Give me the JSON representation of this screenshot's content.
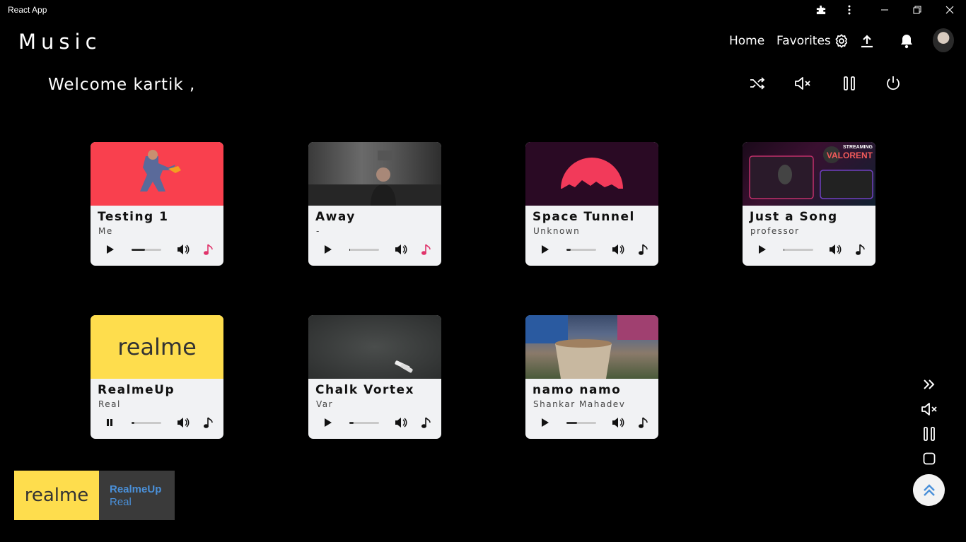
{
  "window": {
    "title": "React App"
  },
  "header": {
    "brand": "Music",
    "nav": [
      "Home",
      "Favorites"
    ],
    "icons": [
      "settings-icon",
      "upload-icon",
      "bell-icon"
    ]
  },
  "welcome": "Welcome kartik ,",
  "controls": [
    "shuffle-icon",
    "mute-icon",
    "pause-icon",
    "power-icon"
  ],
  "cards": [
    {
      "title": "Testing 1",
      "artist": "Me",
      "progress": 0.45,
      "state": "play",
      "favorite": true,
      "thumb": "red"
    },
    {
      "title": "Away",
      "artist": "-",
      "progress": 0.02,
      "state": "play",
      "favorite": true,
      "thumb": "room"
    },
    {
      "title": "Space Tunnel",
      "artist": "Unknown",
      "progress": 0.15,
      "state": "play",
      "favorite": false,
      "thumb": "moon"
    },
    {
      "title": "Just a Song",
      "artist": "professor",
      "progress": 0.0,
      "state": "play",
      "favorite": false,
      "thumb": "gaming",
      "thumb_text": [
        "STREAMING",
        "VALORENT"
      ]
    },
    {
      "title": "RealmeUp",
      "artist": "Real",
      "progress": 0.1,
      "state": "pause",
      "favorite": false,
      "thumb": "realme",
      "thumb_text": [
        "realme"
      ]
    },
    {
      "title": "Chalk Vortex",
      "artist": "Var",
      "progress": 0.15,
      "state": "play",
      "favorite": false,
      "thumb": "chalk"
    },
    {
      "title": "namo namo",
      "artist": "Shankar Mahadev",
      "progress": 0.35,
      "state": "play",
      "favorite": false,
      "thumb": "tea"
    }
  ],
  "side_controls": [
    "next-icon",
    "mute-icon",
    "pause-icon",
    "stop-icon"
  ],
  "mini_player": {
    "logo": "realme",
    "title": "RealmeUp",
    "artist": "Real"
  },
  "colors": {
    "favorite": "#e0336a",
    "accent_blue": "#4a90d9",
    "realme_yellow": "#fedd4d",
    "card_red": "#f9404e"
  }
}
